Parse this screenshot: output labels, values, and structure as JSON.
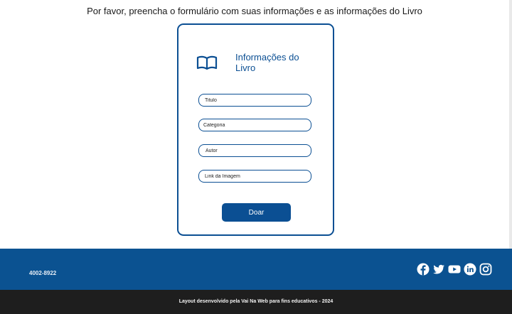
{
  "intro": "Por favor, preencha o formulário com suas informações e as informações do Livro",
  "card": {
    "title": "Informações do Livro",
    "icon": "open-book-icon"
  },
  "fields": {
    "titulo": "Titulo",
    "categoria": "Categoria",
    "autor": "Autor",
    "link": "Link da Imagem"
  },
  "submit_label": "Doar",
  "footer": {
    "phone": "4002-8922",
    "socials": [
      "facebook-icon",
      "twitter-icon",
      "youtube-icon",
      "linkedin-icon",
      "instagram-icon"
    ],
    "credit": "Layout desenvolvido pela Vai Na Web para fins educativos - 2024"
  },
  "colors": {
    "accent": "#0b4f93",
    "footer_top": "#0b5291",
    "footer_bottom": "#1e1e1e"
  }
}
